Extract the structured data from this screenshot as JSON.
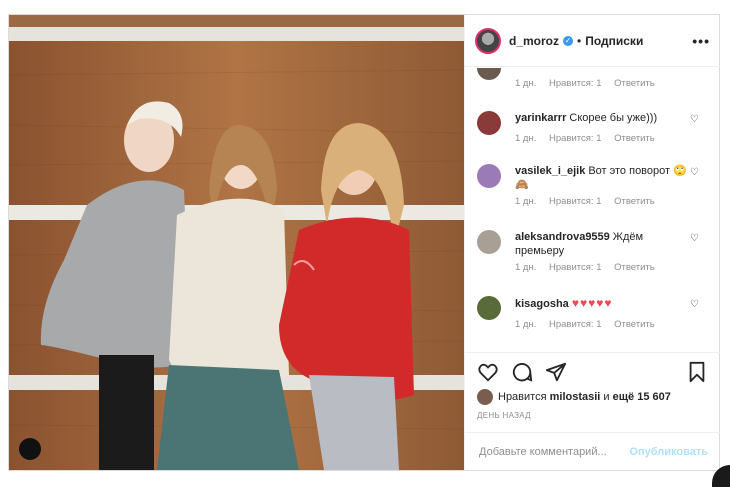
{
  "post": {
    "username": "d_moroz",
    "follow_label": "Подписки",
    "more_label": "•••"
  },
  "comments": [
    {
      "user": "",
      "text": "",
      "time": "1 дн.",
      "likes": "Нравится: 1",
      "reply": "Ответить",
      "avatar_color": "#6b5a4e"
    },
    {
      "user": "yarinkarrr",
      "text": "Скорее бы уже)))",
      "time": "1 дн.",
      "likes": "Нравится: 1",
      "reply": "Ответить",
      "avatar_color": "#8b3a3a"
    },
    {
      "user": "vasilek_i_ejik",
      "text": "Вот это поворот",
      "time": "1 дн.",
      "likes": "Нравится: 1",
      "reply": "Ответить",
      "avatar_color": "#9b7ab8"
    },
    {
      "user": "aleksandrova9559",
      "text": "Ждём премьеру",
      "time": "1 дн.",
      "likes": "Нравится: 1",
      "reply": "Ответить",
      "avatar_color": "#a89f95"
    },
    {
      "user": "kisagosha",
      "text": "♥♥♥♥♥",
      "time": "1 дн.",
      "likes": "Нравится: 1",
      "reply": "Ответить",
      "avatar_color": "#5a6b3a"
    }
  ],
  "likes": {
    "prefix": "Нравится",
    "user": "milostasii",
    "conj": "и",
    "rest": "ещё 15 607"
  },
  "date_label": "ДЕНЬ НАЗАД",
  "add_comment": {
    "placeholder": "Добавьте комментарий...",
    "publish_label": "Опубликовать"
  },
  "colors": {
    "accent_blue": "#3897f0",
    "heart_red": "#ed4956"
  }
}
